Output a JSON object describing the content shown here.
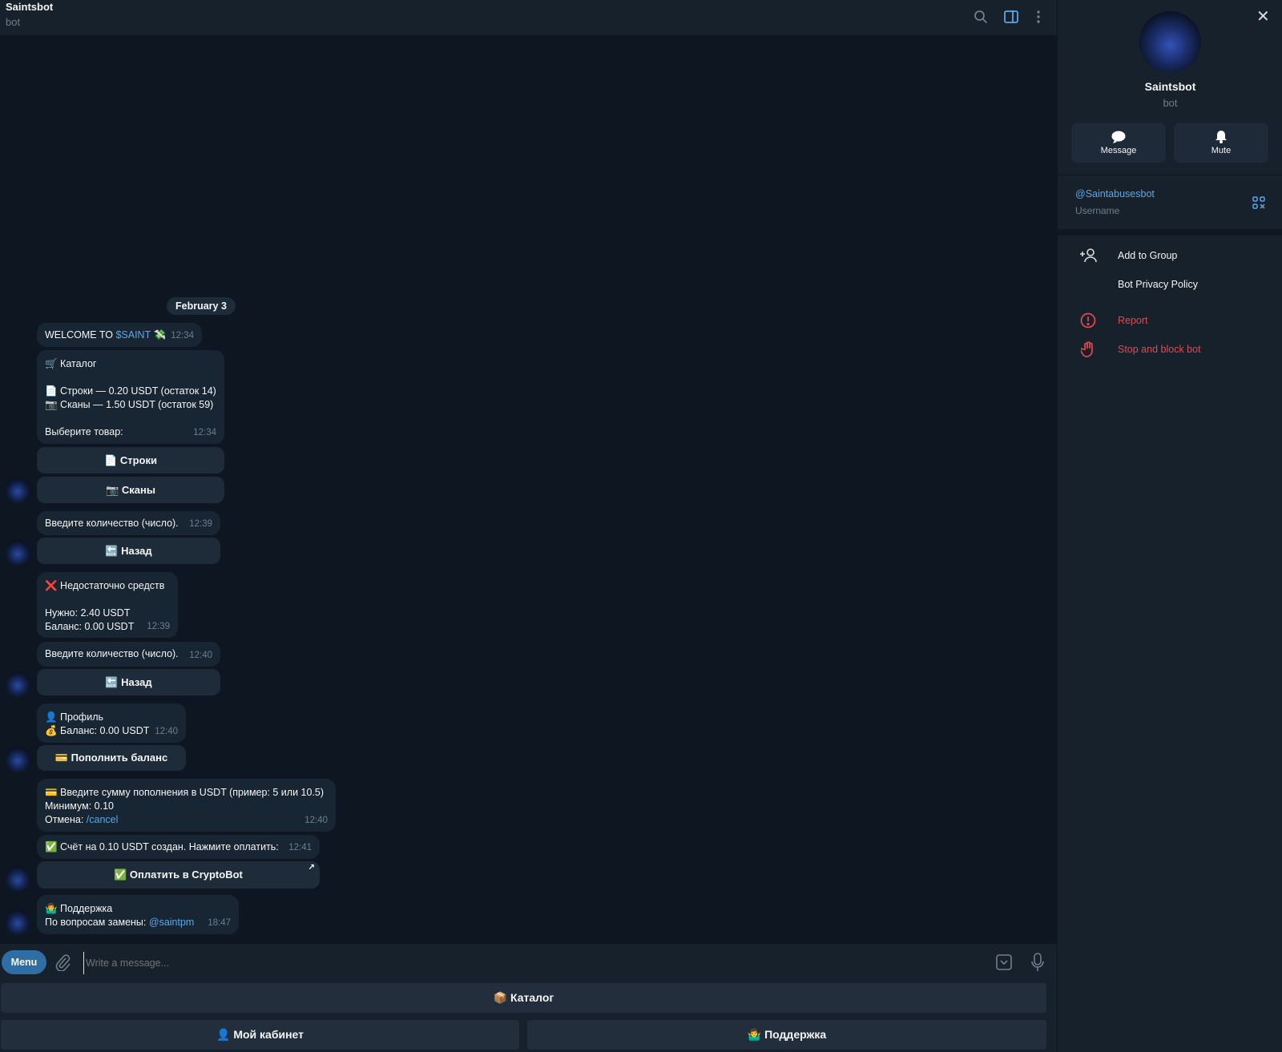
{
  "header": {
    "title": "Saintsbot",
    "subtitle": "bot"
  },
  "date_pill": "February 3",
  "messages": {
    "welcome": {
      "text": "WELCOME TO ",
      "link": "$SAINT",
      "emoji": "💸",
      "time": "12:34"
    },
    "catalog": {
      "title": "🛒 Каталог",
      "line1": "📄 Строки — 0.20 USDT (остаток 14)",
      "line2": "📷 Сканы — 1.50 USDT (остаток 59)",
      "prompt": "Выберите товар:",
      "time": "12:34",
      "btn1": "📄 Строки",
      "btn2": "📷 Сканы"
    },
    "qty1": {
      "text": "Введите количество (число).",
      "time": "12:39",
      "btn": "🔙 Назад"
    },
    "insufficient": {
      "title": "❌ Недостаточно средств",
      "line1": "Нужно: 2.40 USDT",
      "line2": "Баланс: 0.00 USDT",
      "time": "12:39"
    },
    "qty2": {
      "text": "Введите количество (число).",
      "time": "12:40",
      "btn": "🔙 Назад"
    },
    "profile": {
      "line1": "👤 Профиль",
      "line2": "💰 Баланс: 0.00 USDT",
      "time": "12:40",
      "btn": "💳 Пополнить баланс"
    },
    "topup": {
      "line1": "💳 Введите сумму пополнения в USDT (пример: 5 или 10.5)",
      "line2": "Минимум: 0.10",
      "line3": "Отмена: ",
      "link": "/cancel",
      "time": "12:40"
    },
    "invoice": {
      "text": "✅ Счёт на 0.10 USDT создан. Нажмите оплатить:",
      "time": "12:41",
      "btn": "✅ Оплатить в CryptoBot"
    },
    "support": {
      "line1": "🤷‍♂️ Поддержка",
      "line2": "По вопросам замены: ",
      "link": "@saintpm",
      "time": "18:47"
    }
  },
  "composer": {
    "menu": "Menu",
    "placeholder": "Write a message..."
  },
  "keyboard": {
    "catalog": "📦 Каталог",
    "cabinet": "👤 Мой кабинет",
    "support": "🤷‍♂️ Поддержка"
  },
  "panel": {
    "name": "Saintsbot",
    "subtitle": "bot",
    "message": "Message",
    "mute": "Mute",
    "username": "@Saintabusesbot",
    "username_label": "Username",
    "add_group": "Add to Group",
    "privacy": "Bot Privacy Policy",
    "report": "Report",
    "block": "Stop and block bot"
  }
}
